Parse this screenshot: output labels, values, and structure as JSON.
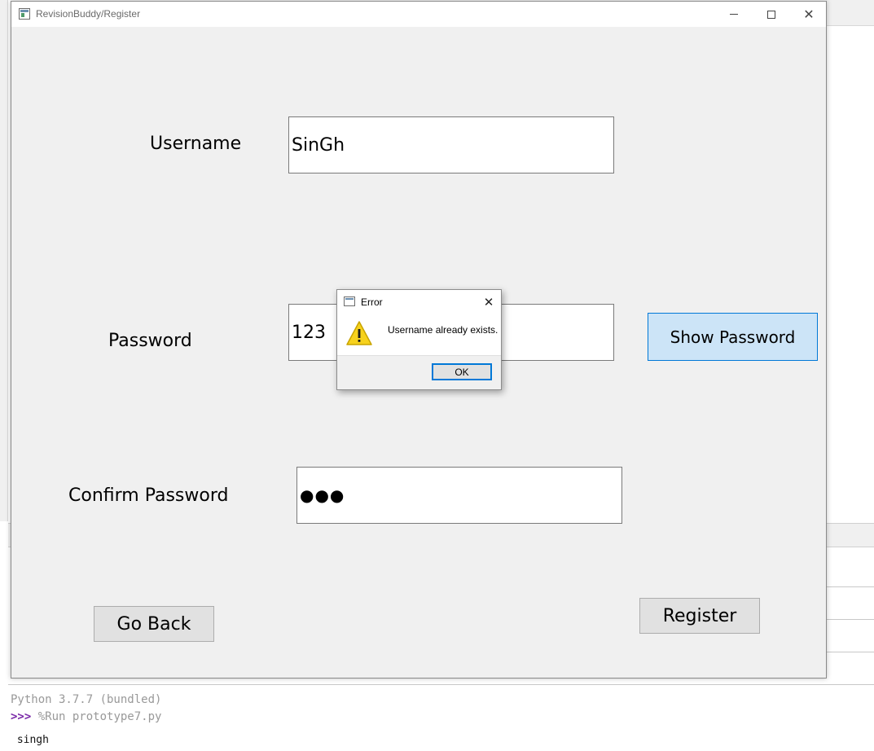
{
  "window": {
    "title": "RevisionBuddy/Register",
    "controls": {
      "minimize": "minimize",
      "maximize": "maximize",
      "close": "✕"
    }
  },
  "form": {
    "username_label": "Username",
    "username_value": "SinGh",
    "password_label": "Password",
    "password_value": "123",
    "confirm_label": "Confirm Password",
    "confirm_value": "●●●",
    "show_password_label": "Show Password",
    "go_back_label": "Go Back",
    "register_label": "Register"
  },
  "dialog": {
    "title": "Error",
    "message": "Username already exists.",
    "ok_label": "OK",
    "close_glyph": "✕",
    "icon": "warning-icon"
  },
  "shell": {
    "version_line": "Python 3.7.7 (bundled)",
    "prompt": ">>>",
    "command": " %Run prototype7.py",
    "output": " singh"
  },
  "colors": {
    "accent": "#0078d7",
    "show_password_bg": "#cce4f7",
    "window_bg": "#f0f0f0",
    "warning_yellow": "#f7d21d"
  }
}
